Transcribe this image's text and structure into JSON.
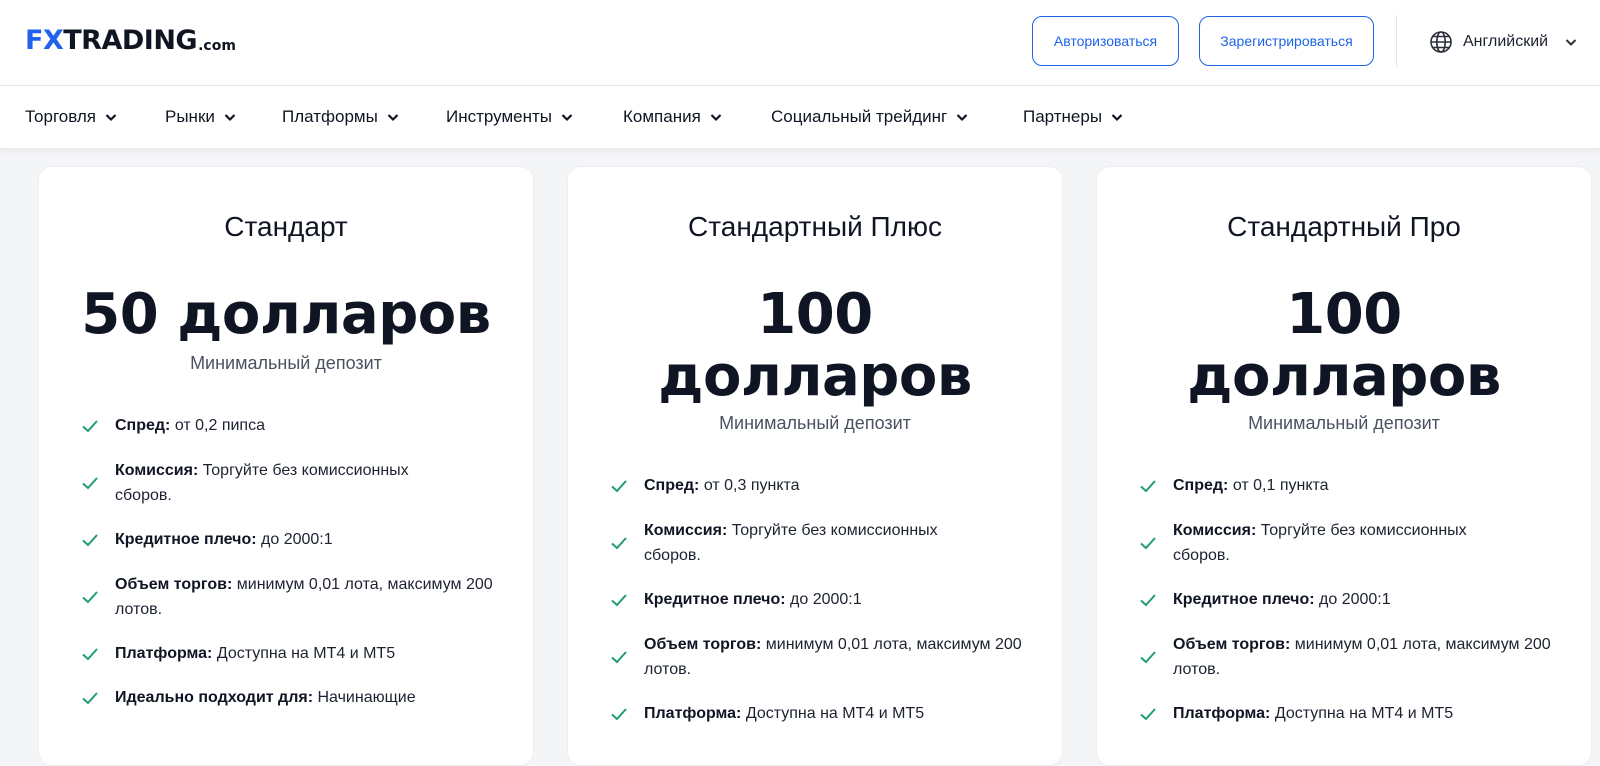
{
  "header": {
    "logo": {
      "fx": "FX",
      "main": "TRADING",
      "suffix": ".com"
    },
    "login_label": "Авторизоваться",
    "register_label": "Зарегистрироваться",
    "language_label": "Английский"
  },
  "nav": {
    "items": [
      {
        "label": "Торговля"
      },
      {
        "label": "Рынки"
      },
      {
        "label": "Платформы"
      },
      {
        "label": "Инструменты"
      },
      {
        "label": "Компания"
      },
      {
        "label": "Социальный трейдинг"
      },
      {
        "label": "Партнеры"
      }
    ]
  },
  "colors": {
    "accent": "#1e63e9",
    "check": "#1f9d6b",
    "text": "#0f1523"
  },
  "cards": [
    {
      "title": "Стандарт",
      "price_line1": "50 долларов",
      "price_line2": "",
      "caption": "Минимальный депозит",
      "features": [
        {
          "label": "Спред:",
          "value": " от 0,2 пипса"
        },
        {
          "label": "Комиссия:",
          "value": " Торгуйте без комиссионных сборов."
        },
        {
          "label": "Кредитное плечо:",
          "value": " до 2000:1"
        },
        {
          "label": "Объем торгов:",
          "value": " минимум 0,01 лота, максимум 200 лотов."
        },
        {
          "label": "Платформа:",
          "value": " Доступна на MT4 и MT5"
        },
        {
          "label": "Идеально подходит для:",
          "value": " Начинающие"
        }
      ]
    },
    {
      "title": "Стандартный Плюс",
      "price_line1": "100",
      "price_line2": "долларов",
      "caption": "Минимальный депозит",
      "features": [
        {
          "label": "Спред:",
          "value": " от 0,3 пункта"
        },
        {
          "label": "Комиссия:",
          "value": " Торгуйте без комиссионных сборов."
        },
        {
          "label": "Кредитное плечо:",
          "value": " до 2000:1"
        },
        {
          "label": "Объем торгов:",
          "value": " минимум 0,01 лота, максимум 200 лотов."
        },
        {
          "label": "Платформа:",
          "value": " Доступна на MT4 и MT5"
        }
      ]
    },
    {
      "title": "Стандартный Про",
      "price_line1": "100",
      "price_line2": "долларов",
      "caption": "Минимальный депозит",
      "features": [
        {
          "label": "Спред:",
          "value": " от 0,1 пункта"
        },
        {
          "label": "Комиссия:",
          "value": " Торгуйте без комиссионных сборов."
        },
        {
          "label": "Кредитное плечо:",
          "value": " до 2000:1"
        },
        {
          "label": "Объем торгов:",
          "value": " минимум 0,01 лота, максимум 200 лотов."
        },
        {
          "label": "Платформа:",
          "value": " Доступна на MT4 и MT5"
        }
      ]
    }
  ]
}
